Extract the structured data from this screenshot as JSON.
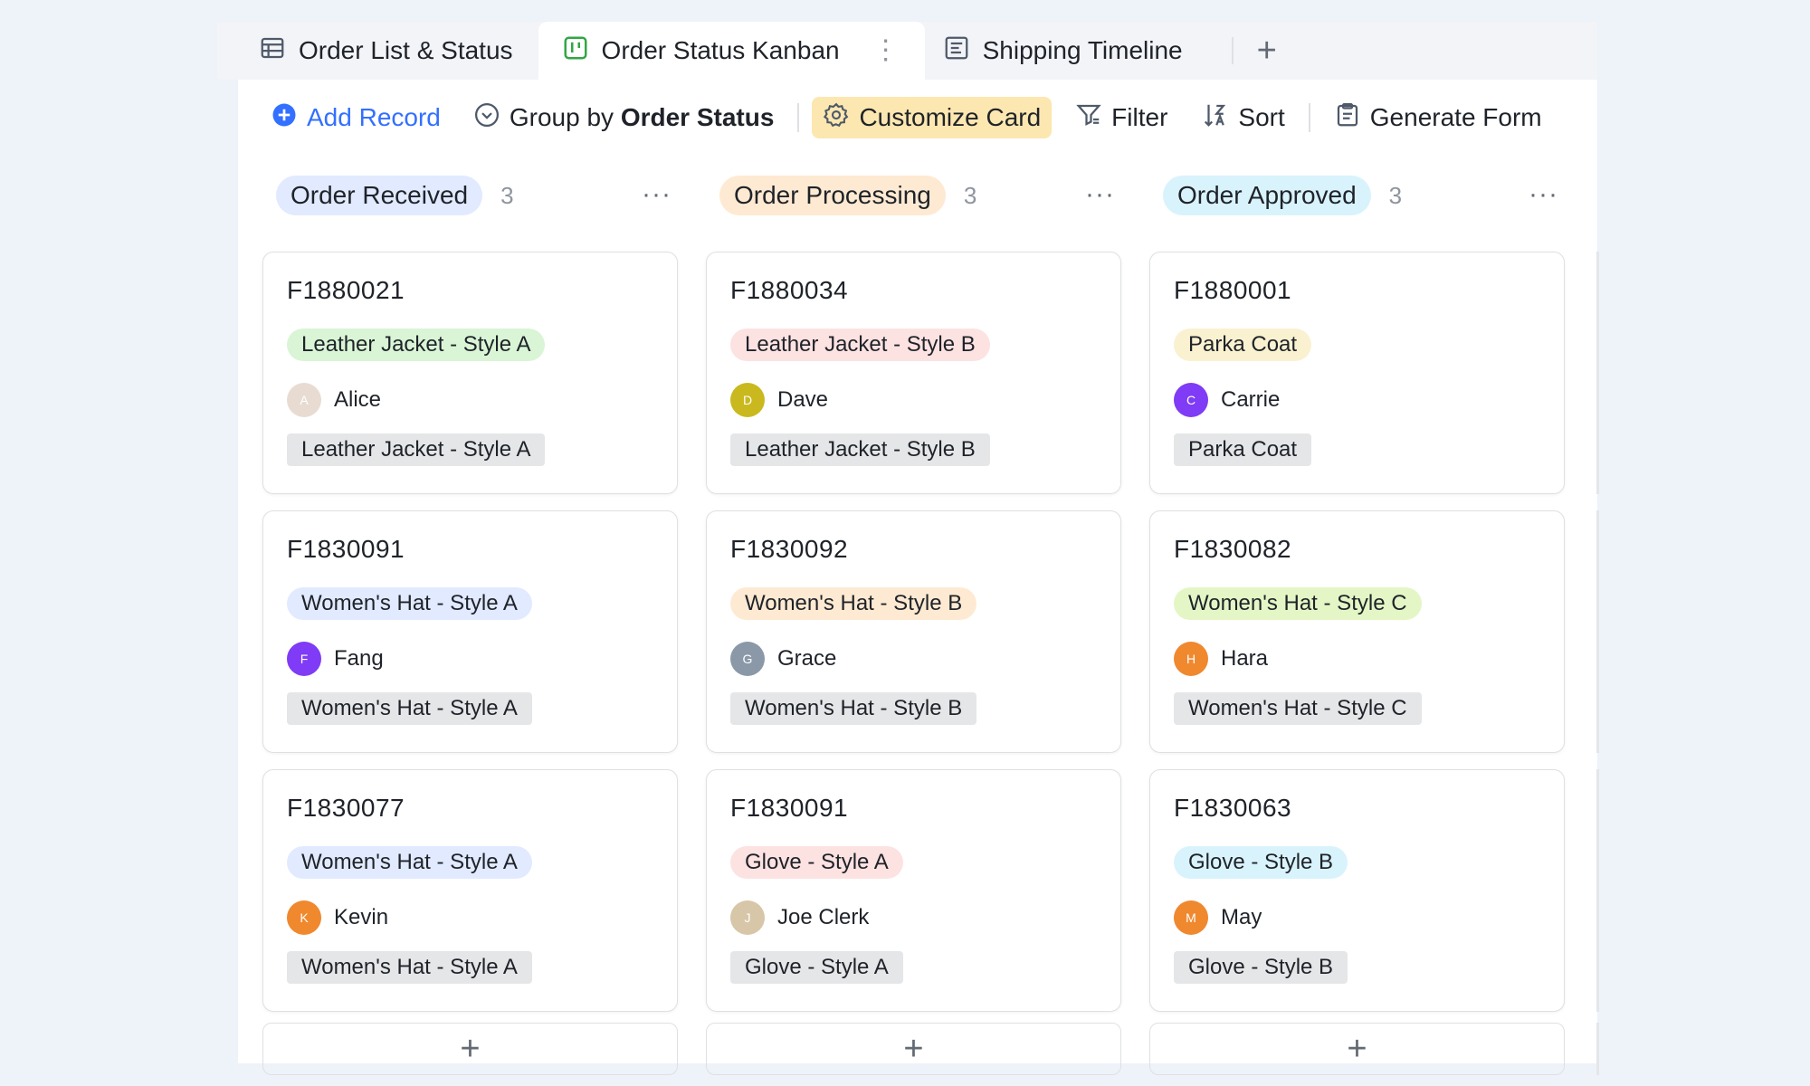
{
  "tabs": [
    {
      "label": "Order List & Status",
      "icon": "table-icon"
    },
    {
      "label": "Order Status Kanban",
      "icon": "kanban-icon",
      "active": true
    },
    {
      "label": "Shipping Timeline",
      "icon": "timeline-icon"
    }
  ],
  "tab_more": "⋮",
  "tab_add": "+",
  "toolbar": {
    "add_record": "Add Record",
    "group_by_prefix": "Group by",
    "group_by_field": "Order Status",
    "customize_card": "Customize Card",
    "filter": "Filter",
    "sort": "Sort",
    "generate_form": "Generate Form"
  },
  "columns": [
    {
      "title": "Order Received",
      "count": "3",
      "menu": "···",
      "pill_color": "#e1eaff",
      "cards": [
        {
          "id": "F1880021",
          "tag": "Leather Jacket - Style A",
          "tag_color": "#d9f5d6",
          "person": "Alice",
          "avatar": "A",
          "avatar_color": "#e8dcd2",
          "field": "Leather Jacket - Style A"
        },
        {
          "id": "F1830091",
          "tag": "Women's Hat - Style A",
          "tag_color": "#e1eaff",
          "person": "Fang",
          "avatar": "F",
          "avatar_color": "#7f3bf5",
          "field": "Women's Hat - Style A"
        },
        {
          "id": "F1830077",
          "tag": "Women's Hat - Style A",
          "tag_color": "#e1eaff",
          "person": "Kevin",
          "avatar": "K",
          "avatar_color": "#f0882e",
          "field": "Women's Hat - Style A"
        }
      ],
      "add": "+"
    },
    {
      "title": "Order Processing",
      "count": "3",
      "menu": "···",
      "pill_color": "#feead2",
      "cards": [
        {
          "id": "F1880034",
          "tag": "Leather Jacket - Style B",
          "tag_color": "#fde2e2",
          "person": "Dave",
          "avatar": "D",
          "avatar_color": "#c9b91e",
          "field": "Leather Jacket - Style B"
        },
        {
          "id": "F1830092",
          "tag": "Women's Hat - Style B",
          "tag_color": "#feead2",
          "person": "Grace",
          "avatar": "G",
          "avatar_color": "#8a98a8",
          "field": "Women's Hat - Style B"
        },
        {
          "id": "F1830091",
          "tag": "Glove - Style A",
          "tag_color": "#fde2e2",
          "person": "Joe Clerk",
          "avatar": "J",
          "avatar_color": "#d7c6a8",
          "field": "Glove - Style A"
        }
      ],
      "add": "+"
    },
    {
      "title": "Order Approved",
      "count": "3",
      "menu": "···",
      "pill_color": "#d9f3fd",
      "cards": [
        {
          "id": "F1880001",
          "tag": "Parka Coat",
          "tag_color": "#faf1d1",
          "person": "Carrie",
          "avatar": "C",
          "avatar_color": "#7f3bf5",
          "field": "Parka Coat"
        },
        {
          "id": "F1830082",
          "tag": "Women's Hat - Style C",
          "tag_color": "#e4f6c5",
          "person": "Hara",
          "avatar": "H",
          "avatar_color": "#f0882e",
          "field": "Women's Hat - Style C"
        },
        {
          "id": "F1830063",
          "tag": "Glove - Style B",
          "tag_color": "#d9f3fd",
          "person": "May",
          "avatar": "M",
          "avatar_color": "#f0882e",
          "field": "Glove - Style B"
        }
      ],
      "add": "+"
    }
  ]
}
